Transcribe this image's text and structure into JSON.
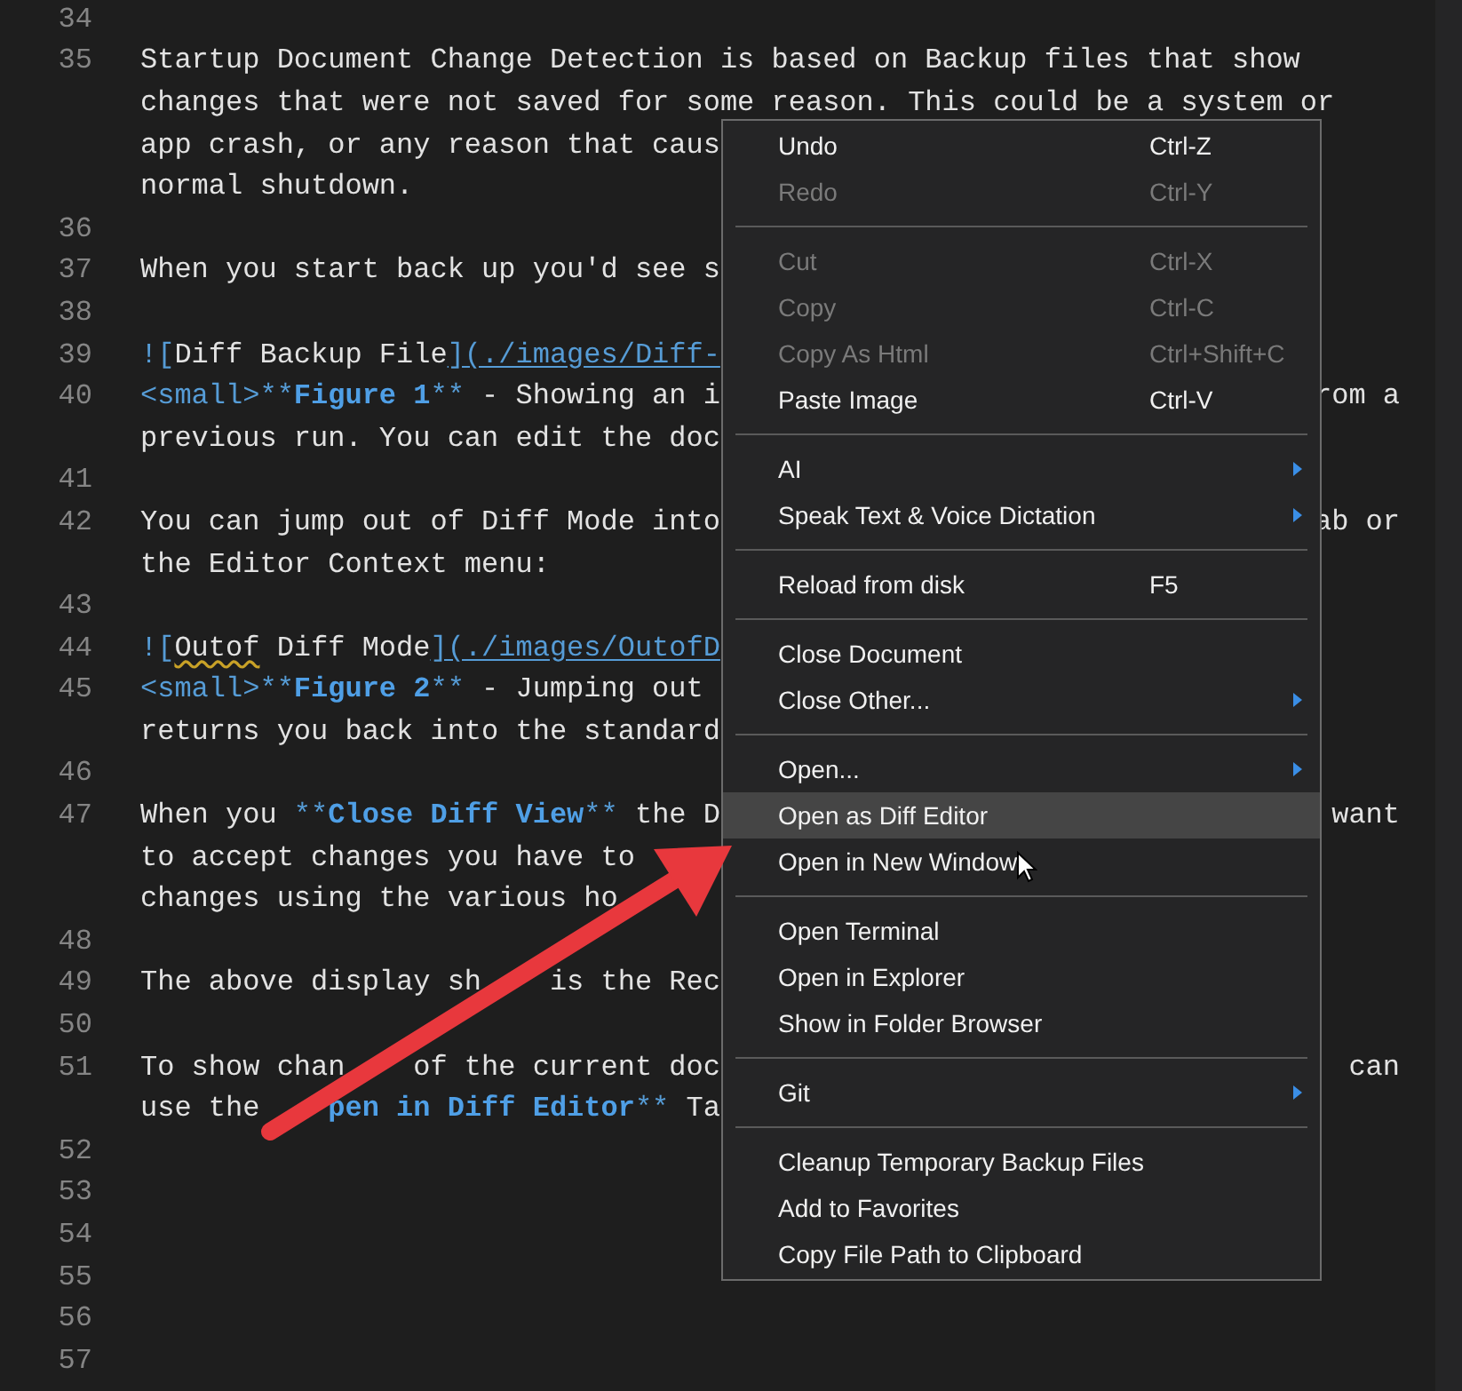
{
  "editor": {
    "lines": [
      {
        "number": "34"
      },
      {
        "number": "35",
        "rows": [
          {
            "segments": [
              {
                "kind": "plain",
                "text": "Startup Document Change Detection is based on Backup files that show"
              }
            ]
          },
          {
            "segments": [
              {
                "kind": "plain",
                "text": "changes that were not saved for some reason. This could be a system or"
              }
            ]
          },
          {
            "segments": [
              {
                "kind": "plain",
                "text": "app crash, or any reason that caus"
              }
            ]
          },
          {
            "segments": [
              {
                "kind": "plain",
                "text": "normal shutdown."
              }
            ]
          }
        ]
      },
      {
        "number": "36"
      },
      {
        "number": "37",
        "rows": [
          {
            "segments": [
              {
                "kind": "plain",
                "text": "When you start back up you'd see s"
              }
            ]
          }
        ]
      },
      {
        "number": "38"
      },
      {
        "number": "39",
        "rows": [
          {
            "segments": [
              {
                "kind": "syntax",
                "text": "!["
              },
              {
                "kind": "plain",
                "text": "Diff Backup File"
              },
              {
                "kind": "url",
                "text": "](./images/Diff-"
              }
            ]
          }
        ]
      },
      {
        "number": "40",
        "rows": [
          {
            "segments": [
              {
                "kind": "syntax",
                "text": "<small>**"
              },
              {
                "kind": "strong",
                "text": "Figure 1"
              },
              {
                "kind": "syntax",
                "text": "**"
              },
              {
                "kind": "plain",
                "text": " - Showing an i"
              }
            ],
            "right": "rom a"
          },
          {
            "segments": [
              {
                "kind": "plain",
                "text": "previous run. You can edit the doc"
              }
            ]
          }
        ]
      },
      {
        "number": "41"
      },
      {
        "number": "42",
        "rows": [
          {
            "segments": [
              {
                "kind": "plain",
                "text": "You can jump out of Diff Mode into"
              }
            ],
            "right": "ab or"
          },
          {
            "segments": [
              {
                "kind": "plain",
                "text": "the Editor Context menu:"
              }
            ]
          }
        ]
      },
      {
        "number": "43"
      },
      {
        "number": "44",
        "rows": [
          {
            "segments": [
              {
                "kind": "syntax",
                "text": "!["
              },
              {
                "kind": "squiggle",
                "text": "Outof"
              },
              {
                "kind": "plain",
                "text": " Diff Mode"
              },
              {
                "kind": "url",
                "text": "](./images/OutofD"
              }
            ]
          }
        ]
      },
      {
        "number": "45",
        "rows": [
          {
            "segments": [
              {
                "kind": "syntax",
                "text": "<small>**"
              },
              {
                "kind": "strong",
                "text": "Figure 2"
              },
              {
                "kind": "syntax",
                "text": "**"
              },
              {
                "kind": "plain",
                "text": " - Jumping out"
              }
            ]
          },
          {
            "segments": [
              {
                "kind": "plain",
                "text": "returns you back into the standard"
              }
            ]
          }
        ]
      },
      {
        "number": "46"
      },
      {
        "number": "47",
        "rows": [
          {
            "segments": [
              {
                "kind": "plain",
                "text": "When you "
              },
              {
                "kind": "syntax",
                "text": "**"
              },
              {
                "kind": "strong",
                "text": "Close Diff View"
              },
              {
                "kind": "syntax",
                "text": "**"
              },
              {
                "kind": "plain",
                "text": " the D"
              }
            ],
            "right": "want"
          },
          {
            "segments": [
              {
                "kind": "plain",
                "text": "to accept changes you have to"
              }
            ]
          },
          {
            "segments": [
              {
                "kind": "plain",
                "text": "changes using the various ho"
              }
            ]
          }
        ]
      },
      {
        "number": "48"
      },
      {
        "number": "49",
        "rows": [
          {
            "segments": [
              {
                "kind": "plain",
                "text": "The above display sh"
              },
              {
                "kind": "covered"
              },
              {
                "kind": "covered"
              },
              {
                "kind": "plain",
                "text": "is the Rec"
              }
            ]
          }
        ]
      },
      {
        "number": "50"
      },
      {
        "number": "51",
        "rows": [
          {
            "segments": [
              {
                "kind": "plain",
                "text": "To show chan"
              },
              {
                "kind": "covered"
              },
              {
                "kind": "covered"
              },
              {
                "kind": "plain",
                "text": "of the current doc"
              }
            ],
            "right": "can"
          },
          {
            "segments": [
              {
                "kind": "plain",
                "text": "use the"
              },
              {
                "kind": "covered"
              },
              {
                "kind": "covered"
              },
              {
                "kind": "strong",
                "text": "pen in Diff Editor"
              },
              {
                "kind": "syntax",
                "text": "**"
              },
              {
                "kind": "plain",
                "text": " Ta"
              }
            ]
          }
        ]
      },
      {
        "number": "52"
      },
      {
        "number": "53"
      },
      {
        "number": "54"
      },
      {
        "number": "55"
      },
      {
        "number": "56"
      },
      {
        "number": "57"
      }
    ]
  },
  "context_menu": {
    "items": [
      {
        "kind": "item",
        "label": "Undo",
        "shortcut": "Ctrl-Z",
        "disabled": false,
        "submenu": false,
        "selected": false
      },
      {
        "kind": "item",
        "label": "Redo",
        "shortcut": "Ctrl-Y",
        "disabled": true,
        "submenu": false,
        "selected": false
      },
      {
        "kind": "separator"
      },
      {
        "kind": "item",
        "label": "Cut",
        "shortcut": "Ctrl-X",
        "disabled": true,
        "submenu": false,
        "selected": false
      },
      {
        "kind": "item",
        "label": "Copy",
        "shortcut": "Ctrl-C",
        "disabled": true,
        "submenu": false,
        "selected": false
      },
      {
        "kind": "item",
        "label": "Copy As Html",
        "shortcut": "Ctrl+Shift+C",
        "disabled": true,
        "submenu": false,
        "selected": false
      },
      {
        "kind": "item",
        "label": "Paste Image",
        "shortcut": "Ctrl-V",
        "disabled": false,
        "submenu": false,
        "selected": false
      },
      {
        "kind": "separator"
      },
      {
        "kind": "item",
        "label": "AI",
        "disabled": false,
        "submenu": true,
        "selected": false
      },
      {
        "kind": "item",
        "label": "Speak Text & Voice Dictation",
        "disabled": false,
        "submenu": true,
        "selected": false
      },
      {
        "kind": "separator"
      },
      {
        "kind": "item",
        "label": "Reload from disk",
        "shortcut": "F5",
        "disabled": false,
        "submenu": false,
        "selected": false
      },
      {
        "kind": "separator"
      },
      {
        "kind": "item",
        "label": "Close Document",
        "disabled": false,
        "submenu": false,
        "selected": false
      },
      {
        "kind": "item",
        "label": "Close Other...",
        "disabled": false,
        "submenu": true,
        "selected": false
      },
      {
        "kind": "separator"
      },
      {
        "kind": "item",
        "label": "Open...",
        "disabled": false,
        "submenu": true,
        "selected": false
      },
      {
        "kind": "item",
        "label": "Open as Diff Editor",
        "disabled": false,
        "submenu": false,
        "selected": true
      },
      {
        "kind": "item",
        "label": "Open in New Window",
        "disabled": false,
        "submenu": false,
        "selected": false
      },
      {
        "kind": "separator"
      },
      {
        "kind": "item",
        "label": "Open Terminal",
        "disabled": false,
        "submenu": false,
        "selected": false
      },
      {
        "kind": "item",
        "label": "Open in Explorer",
        "disabled": false,
        "submenu": false,
        "selected": false
      },
      {
        "kind": "item",
        "label": "Show in Folder Browser",
        "disabled": false,
        "submenu": false,
        "selected": false
      },
      {
        "kind": "separator"
      },
      {
        "kind": "item",
        "label": "Git",
        "disabled": false,
        "submenu": true,
        "selected": false
      },
      {
        "kind": "separator"
      },
      {
        "kind": "item",
        "label": "Cleanup Temporary Backup Files",
        "disabled": false,
        "submenu": false,
        "selected": false
      },
      {
        "kind": "item",
        "label": "Add to Favorites",
        "disabled": false,
        "submenu": false,
        "selected": false
      },
      {
        "kind": "item",
        "label": "Copy File Path to Clipboard",
        "disabled": false,
        "submenu": false,
        "selected": false
      }
    ]
  }
}
